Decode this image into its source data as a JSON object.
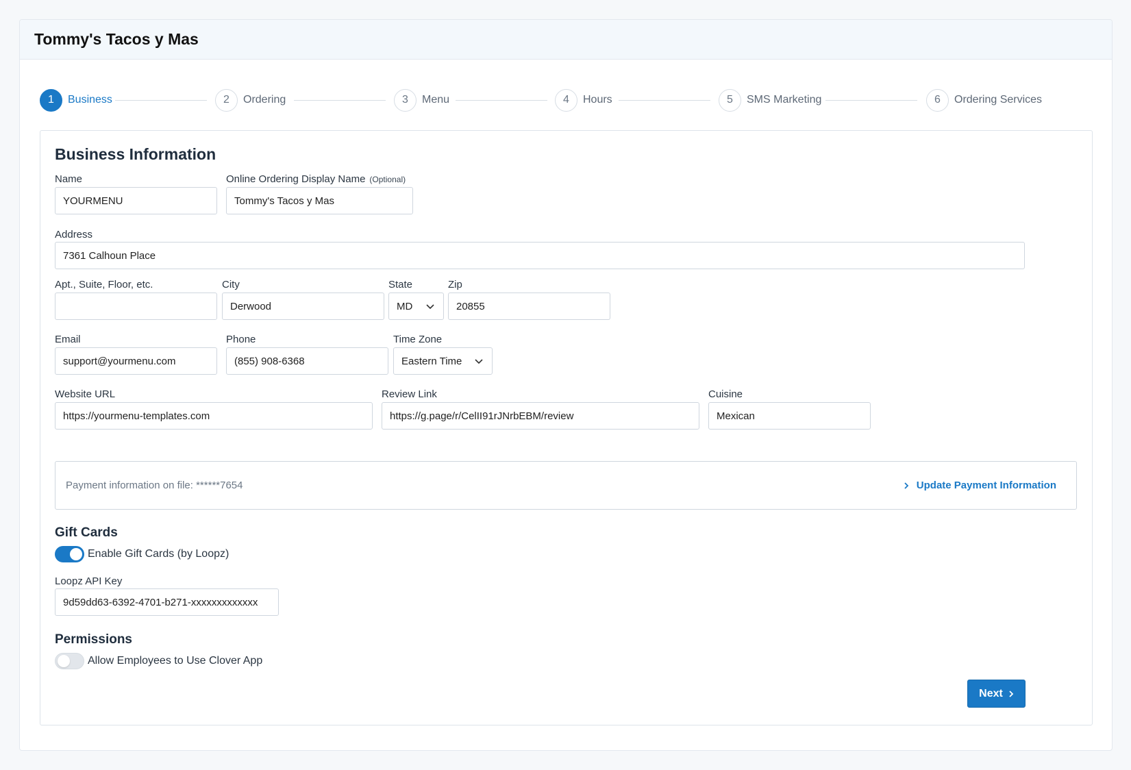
{
  "header": {
    "title": "Tommy's Tacos y Mas"
  },
  "stepper": {
    "steps": [
      {
        "num": "1",
        "label": "Business"
      },
      {
        "num": "2",
        "label": "Ordering"
      },
      {
        "num": "3",
        "label": "Menu"
      },
      {
        "num": "4",
        "label": "Hours"
      },
      {
        "num": "5",
        "label": "SMS Marketing"
      },
      {
        "num": "6",
        "label": "Ordering Services"
      }
    ],
    "active_step": "Business"
  },
  "form": {
    "heading": "Business Information",
    "name": {
      "label": "Name",
      "value": "YOURMENU"
    },
    "display_name": {
      "label": "Online Ordering Display Name",
      "optional": "(Optional)",
      "value": "Tommy's Tacos y Mas"
    },
    "address": {
      "label": "Address",
      "value": "7361 Calhoun Place"
    },
    "apt": {
      "label": "Apt., Suite, Floor, etc.",
      "value": ""
    },
    "city": {
      "label": "City",
      "value": "Derwood"
    },
    "state": {
      "label": "State",
      "value": "MD"
    },
    "zip": {
      "label": "Zip",
      "value": "20855"
    },
    "email": {
      "label": "Email",
      "value": "support@yourmenu.com"
    },
    "phone": {
      "label": "Phone",
      "value": "(855) 908-6368"
    },
    "timezone": {
      "label": "Time Zone",
      "value": "Eastern Time"
    },
    "website": {
      "label": "Website URL",
      "value": "https://yourmenu-templates.com"
    },
    "review": {
      "label": "Review Link",
      "value": "https://g.page/r/CelII91rJNrbEBM/review"
    },
    "cuisine": {
      "label": "Cuisine",
      "value": "Mexican"
    }
  },
  "payment": {
    "info": "Payment information on file: ******7654",
    "update_label": "Update Payment Information"
  },
  "gift_cards": {
    "heading": "Gift Cards",
    "toggle_label": "Enable Gift Cards (by Loopz)",
    "enabled": true,
    "api_key_label": "Loopz API Key",
    "api_key_value": "9d59dd63-6392-4701-b271-xxxxxxxxxxxxx"
  },
  "permissions": {
    "heading": "Permissions",
    "toggle_label": "Allow Employees to Use Clover App",
    "enabled": false
  },
  "actions": {
    "next_label": "Next"
  },
  "colors": {
    "accent": "#1a79c6",
    "header_bg": "#f3f8fc",
    "page_bg": "#f6f8fa"
  }
}
